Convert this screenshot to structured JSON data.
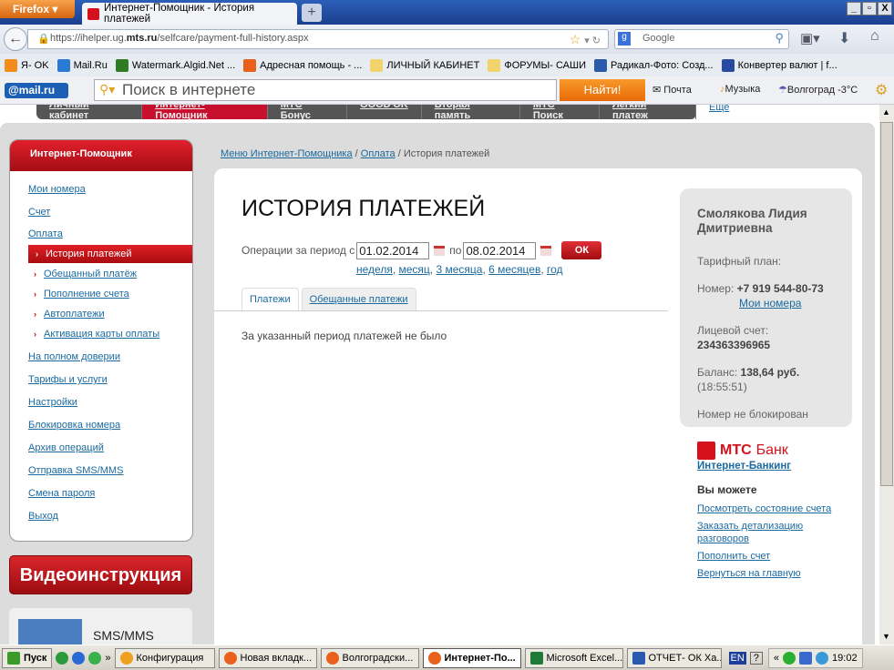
{
  "browser": {
    "menu_button": "Firefox",
    "tab_title": "Интернет-Помощник - История платежей",
    "new_tab": "+",
    "url_prefix": "https://ihelper.ug.",
    "url_domain": "mts.ru",
    "url_path": "/selfcare/payment-full-history.aspx",
    "search_engine": "Google",
    "window_controls": [
      "_",
      "▫",
      "X"
    ]
  },
  "bookmarks": [
    {
      "label": "Я- OK",
      "color": "#f28c1a"
    },
    {
      "label": "Mail.Ru",
      "color": "#2a7bd6"
    },
    {
      "label": "Watermark.Algid.Net ...",
      "color": "#2d7b23"
    },
    {
      "label": "Адресная помощь - ...",
      "color": "#e8601a"
    },
    {
      "label": "ЛИЧНЫЙ КАБИНЕТ",
      "color": "#f2d36b"
    },
    {
      "label": "ФОРУМЫ- САШИ",
      "color": "#f2d36b"
    },
    {
      "label": "Радикал-Фото: Созд...",
      "color": "#2a5aa8"
    },
    {
      "label": "Конвертер валют | f...",
      "color": "#2a4aa0"
    }
  ],
  "mailru": {
    "logo": "@mail.ru",
    "search_placeholder": "Поиск в интернете",
    "find_button": "Найти!",
    "mail": "Почта",
    "music": "Музыка",
    "weather": "Волгоград -3°C"
  },
  "topnav": [
    "Личный кабинет",
    "Интернет-Помощник",
    "МТС Бонус",
    "GOOD'OK",
    "Вторая память",
    "МТС Поиск",
    "Легкий платеж"
  ],
  "topnav_more": "Еще",
  "sidebar": {
    "title": "Интернет-Помощник",
    "items_top": [
      "Мои номера",
      "Счет",
      "Оплата"
    ],
    "subitems": [
      "История платежей",
      "Обещанный платёж",
      "Пополнение счета",
      "Автоплатежи",
      "Активация карты оплаты"
    ],
    "items_bottom": [
      "На полном доверии",
      "Тарифы и услуги",
      "Настройки",
      "Блокировка номера",
      "Архив операций",
      "Отправка SMS/MMS",
      "Смена пароля",
      "Выход"
    ],
    "video_button": "Видеоинструкция",
    "sms_promo": "SMS/MMS"
  },
  "breadcrumb": {
    "items": [
      "Меню Интернет-Помощника",
      "Оплата"
    ],
    "current": "История платежей",
    "sep": "/"
  },
  "main": {
    "title": "ИСТОРИЯ ПЛАТЕЖЕЙ",
    "period_label": "Операции за период с",
    "date_from": "01.02.2014",
    "to_label": "по",
    "date_to": "08.02.2014",
    "ok_button": "ОК",
    "quick_periods": [
      "неделя",
      "месяц",
      "3 месяца",
      "6 месяцев",
      "год"
    ],
    "tabs": [
      "Платежи",
      "Обещанные платежи"
    ],
    "empty_message": "За указанный период платежей не было"
  },
  "account": {
    "name": "Смолякова Лидия Дмитриевна",
    "tariff_label": "Тарифный план:",
    "number_label": "Номер:",
    "number": "+7 919 544-80-73",
    "my_numbers_link": "Мои номера",
    "account_label": "Лицевой счет:",
    "account_number": "234363396965",
    "balance_label": "Баланс:",
    "balance": "138,64 руб.",
    "balance_time": "(18:55:51)",
    "status": "Номер не блокирован"
  },
  "bank": {
    "logo_bold": "МТС",
    "logo_rest": "Банк",
    "internet_banking": "Интернет-Банкинг",
    "you_can": "Вы можете",
    "links": [
      "Посмотреть состояние счета",
      "Заказать детализацию разговоров",
      "Пополнить счет",
      "Вернуться на главную"
    ]
  },
  "taskbar": {
    "start": "Пуск",
    "chevron": "»",
    "items": [
      "Конфигурация",
      "Новая вкладк...",
      "Волгоградски...",
      "Интернет-По...",
      "Microsoft Excel...",
      "ОТЧЕТ- ОК Ха..."
    ],
    "lang": "EN",
    "help": "?",
    "clock": "19:02"
  }
}
